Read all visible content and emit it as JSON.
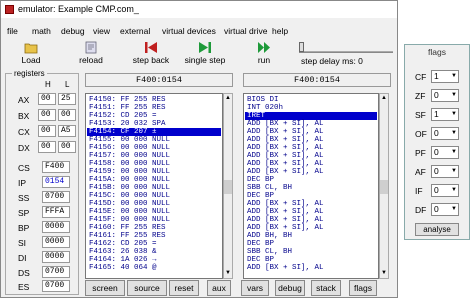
{
  "window": {
    "title": "emulator: Example CMP.com_"
  },
  "menu": [
    "file",
    "math",
    "debug",
    "view",
    "external",
    "virtual devices",
    "virtual drive",
    "help"
  ],
  "toolbar": {
    "load": "Load",
    "reload": "reload",
    "step_back": "step back",
    "single_step": "single step",
    "run": "run",
    "step_delay": "step delay ms: 0"
  },
  "registers": {
    "caption": "registers",
    "h": "H",
    "l": "L",
    "ax": {
      "name": "AX",
      "h": "00",
      "l": "25"
    },
    "bx": {
      "name": "BX",
      "h": "00",
      "l": "00"
    },
    "cx": {
      "name": "CX",
      "h": "00",
      "l": "A5"
    },
    "dx": {
      "name": "DX",
      "h": "00",
      "l": "00"
    },
    "cs": {
      "name": "CS",
      "v": "F400"
    },
    "ip": {
      "name": "IP",
      "v": "0154"
    },
    "ss": {
      "name": "SS",
      "v": "0700"
    },
    "sp": {
      "name": "SP",
      "v": "FFFA"
    },
    "bp": {
      "name": "BP",
      "v": "0000"
    },
    "si": {
      "name": "SI",
      "v": "0000"
    },
    "di": {
      "name": "DI",
      "v": "0000"
    },
    "ds": {
      "name": "DS",
      "v": "0700"
    },
    "es": {
      "name": "ES",
      "v": "0700"
    }
  },
  "memory": {
    "address": "F400:0154",
    "selected_index": 4,
    "rows": [
      "F4150: FF 255 RES",
      "F4151: FF 255 RES",
      "F4152: CD 205 =",
      "F4153: 20 032 SPA",
      "F4154: CF 207 ±",
      "F4155: 00 000 NULL",
      "F4156: 00 000 NULL",
      "F4157: 00 000 NULL",
      "F4158: 00 000 NULL",
      "F4159: 00 000 NULL",
      "F415A: 00 000 NULL",
      "F415B: 00 000 NULL",
      "F415C: 00 000 NULL",
      "F415D: 00 000 NULL",
      "F415E: 00 000 NULL",
      "F415F: 00 000 NULL",
      "F4160: FF 255 RES",
      "F4161: FF 255 RES",
      "F4162: CD 205 =",
      "F4163: 26 038 &",
      "F4164: 1A 026 →",
      "F4165: 40 064 @"
    ]
  },
  "disasm": {
    "address": "F400:0154",
    "selected_index": 2,
    "rows": [
      "BIOS DI",
      "INT 020h",
      "IRET",
      "ADD [BX + SI], AL",
      "ADD [BX + SI], AL",
      "ADD [BX + SI], AL",
      "ADD [BX + SI], AL",
      "ADD [BX + SI], AL",
      "ADD [BX + SI], AL",
      "ADD [BX + SI], AL",
      "DEC BP",
      "SBB CL, BH",
      "DEC BP",
      "ADD [BX + SI], AL",
      "ADD [BX + SI], AL",
      "ADD [BX + SI], AL",
      "ADD [BX + SI], AL",
      "ADD BH, BH",
      "DEC BP",
      "SBB CL, BH",
      "DEC BP",
      "ADD [BX + SI], AL"
    ]
  },
  "bottom_buttons": [
    "screen",
    "source",
    "reset",
    "aux",
    "vars",
    "debug",
    "stack",
    "flags"
  ],
  "flags": {
    "title": "flags",
    "items": [
      {
        "name": "CF",
        "value": "1"
      },
      {
        "name": "ZF",
        "value": "0"
      },
      {
        "name": "SF",
        "value": "1"
      },
      {
        "name": "OF",
        "value": "0"
      },
      {
        "name": "PF",
        "value": "0"
      },
      {
        "name": "AF",
        "value": "0"
      },
      {
        "name": "IF",
        "value": "0"
      },
      {
        "name": "DF",
        "value": "0"
      }
    ],
    "analyse": "analyse"
  },
  "colors": {
    "selection": "#0000cc",
    "memory_text": "#00008b"
  }
}
